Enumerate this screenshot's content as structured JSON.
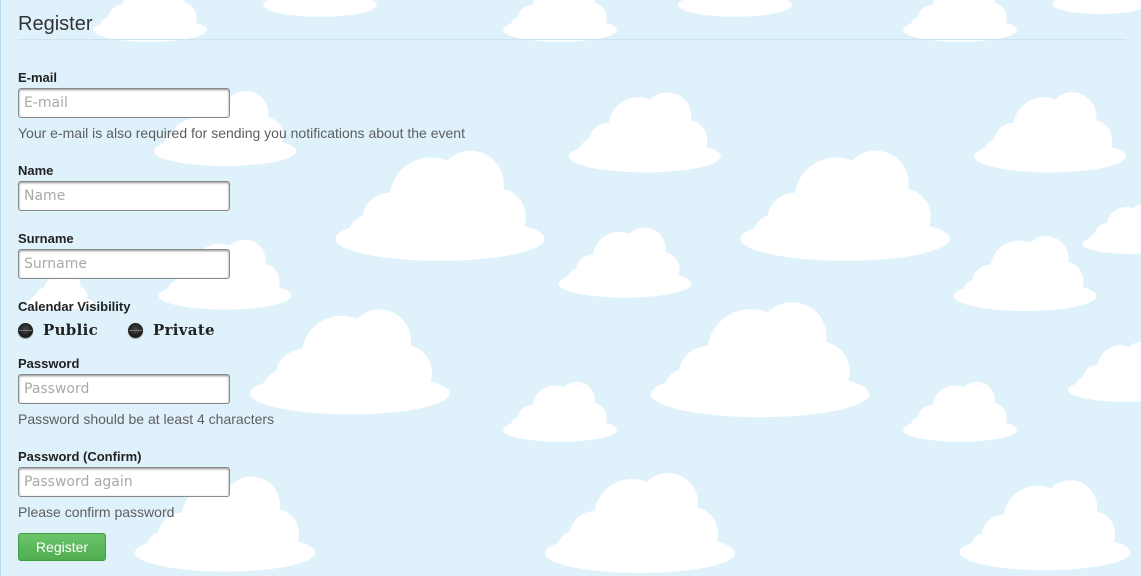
{
  "form": {
    "legend": "Register",
    "email": {
      "label": "E-mail",
      "placeholder": "E-mail",
      "value": "",
      "help": "Your e-mail is also required for sending you notifications about the event"
    },
    "name": {
      "label": "Name",
      "placeholder": "Name",
      "value": ""
    },
    "surname": {
      "label": "Surname",
      "placeholder": "Surname",
      "value": ""
    },
    "visibility": {
      "label": "Calendar Visibility",
      "options": [
        "Public",
        "Private"
      ]
    },
    "password": {
      "label": "Password",
      "placeholder": "Password",
      "value": "",
      "help": "Password should be at least 4 characters"
    },
    "password_confirm": {
      "label": "Password (Confirm)",
      "placeholder": "Password again",
      "value": "",
      "help": "Please confirm password"
    },
    "submit_label": "Register"
  },
  "theme": {
    "sky_color": "#dff1fb",
    "cloud_color": "#ffffff",
    "button_color": "#5cb85c",
    "background": "clouds-pattern"
  }
}
